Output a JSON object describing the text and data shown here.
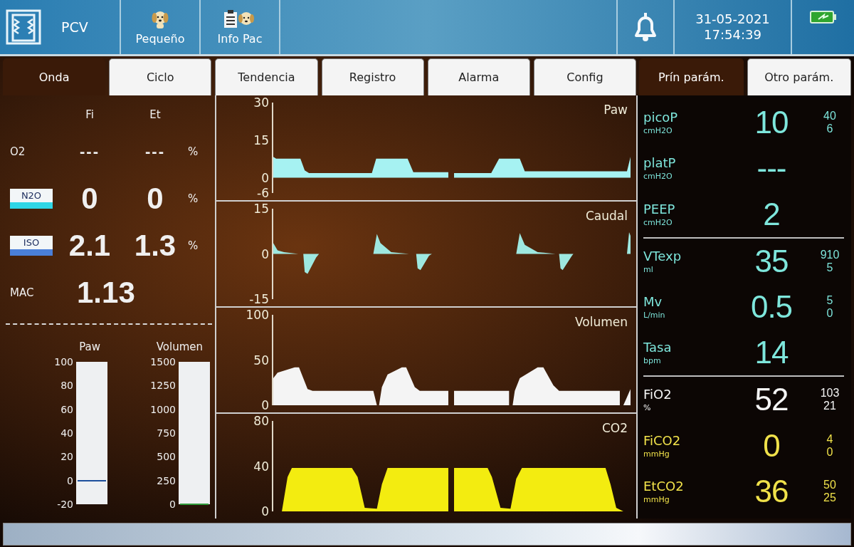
{
  "top_bar": {
    "mode": "PCV",
    "patient_size": "Pequeño",
    "patient_info": "Info Pac",
    "date": "31-05-2021",
    "time": "17:54:39"
  },
  "tabs": [
    {
      "label": "Onda",
      "selected": true
    },
    {
      "label": "Ciclo",
      "selected": false
    },
    {
      "label": "Tendencia",
      "selected": false
    },
    {
      "label": "Registro",
      "selected": false
    },
    {
      "label": "Alarma",
      "selected": false
    },
    {
      "label": "Config",
      "selected": false
    }
  ],
  "param_tabs": [
    {
      "label": "Prín parám.",
      "selected": true
    },
    {
      "label": "Otro parám.",
      "selected": false
    }
  ],
  "gases": {
    "columns": [
      "Fi",
      "Et"
    ],
    "rows": [
      {
        "kind": "plain",
        "label": "O2",
        "fi": "---",
        "et": "---",
        "unit": "%"
      },
      {
        "kind": "agent",
        "label": "N2O",
        "color": "#2fd6e6",
        "fi": "0",
        "et": "0",
        "unit": "%"
      },
      {
        "kind": "agent",
        "label": "ISO",
        "color": "#4a7fd8",
        "fi": "2.1",
        "et": "1.3",
        "unit": "%"
      }
    ],
    "mac": {
      "label": "MAC",
      "value": "1.13"
    }
  },
  "gauges": [
    {
      "label": "Paw",
      "ticks": [
        "100",
        "80",
        "60",
        "40",
        "20",
        "0",
        "-20"
      ],
      "level": 0.167,
      "color": "#1c4f9c"
    },
    {
      "label": "Volumen",
      "ticks": [
        "1500",
        "1250",
        "1000",
        "750",
        "500",
        "250",
        "0"
      ],
      "level": 0.0,
      "color": "#2f9a3a"
    }
  ],
  "waveforms": [
    {
      "label": "Paw",
      "kind": "pressure",
      "color": "#a6f2f2",
      "ticks": [
        "30",
        "15",
        "0",
        "-6"
      ]
    },
    {
      "label": "Caudal",
      "kind": "flow",
      "color": "#9ee8e0",
      "ticks": [
        "15",
        "0",
        "-15"
      ]
    },
    {
      "label": "Volumen",
      "kind": "volume",
      "color": "#f4f4f4",
      "ticks": [
        "100",
        "50",
        "0"
      ]
    },
    {
      "label": "CO2",
      "kind": "co2",
      "color": "#f3ec10",
      "ticks": [
        "80",
        "40",
        "0"
      ]
    }
  ],
  "param_groups": [
    [
      {
        "label": "picoP",
        "unit": "cmH2O",
        "value": "10",
        "limits": [
          "40",
          "6"
        ],
        "color": "#7ee6dc"
      },
      {
        "label": "platP",
        "unit": "cmH2O",
        "value": "---",
        "color": "#7ee6dc"
      },
      {
        "label": "PEEP",
        "unit": "cmH2O",
        "value": "2",
        "color": "#7ee6dc"
      }
    ],
    [
      {
        "label": "VTexp",
        "unit": "ml",
        "value": "35",
        "limits": [
          "910",
          "5"
        ],
        "color": "#7ee6dc"
      },
      {
        "label": "Mv",
        "unit": "L/min",
        "value": "0.5",
        "limits": [
          "5",
          "0"
        ],
        "color": "#7ee6dc"
      },
      {
        "label": "Tasa",
        "unit": "bpm",
        "value": "14",
        "color": "#7ee6dc"
      }
    ],
    [
      {
        "label": "FiO2",
        "unit": "%",
        "value": "52",
        "limits": [
          "103",
          "21"
        ],
        "color": "#f4f4f4"
      },
      {
        "label": "FiCO2",
        "unit": "mmHg",
        "value": "0",
        "limits": [
          "4",
          "0"
        ],
        "color": "#f0e14a"
      },
      {
        "label": "EtCO2",
        "unit": "mmHg",
        "value": "36",
        "limits": [
          "50",
          "25"
        ],
        "color": "#f0e14a"
      }
    ]
  ]
}
